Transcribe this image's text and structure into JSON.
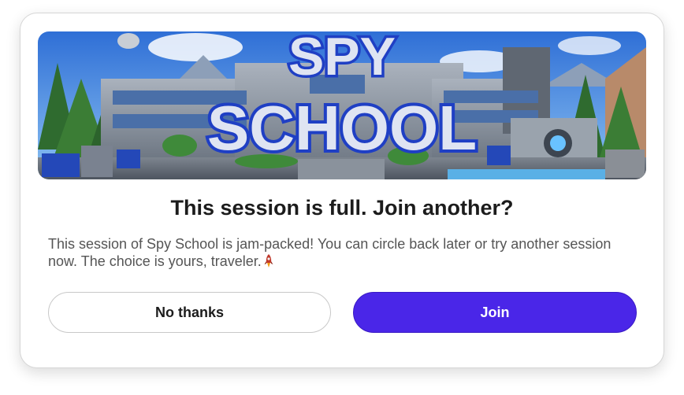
{
  "banner": {
    "title_line1": "SPY",
    "title_line2": "SCHOOL"
  },
  "dialog": {
    "heading": "This session is full. Join another?",
    "message": "This session of Spy School is jam-packed! You can circle back later or try another session now. The choice is yours, traveler.",
    "emoji_icon": "rocket-icon"
  },
  "actions": {
    "secondary_label": "No thanks",
    "primary_label": "Join"
  },
  "colors": {
    "primary": "#4a26e8",
    "title_text": "#1c1c1c",
    "body_text": "#555555"
  }
}
